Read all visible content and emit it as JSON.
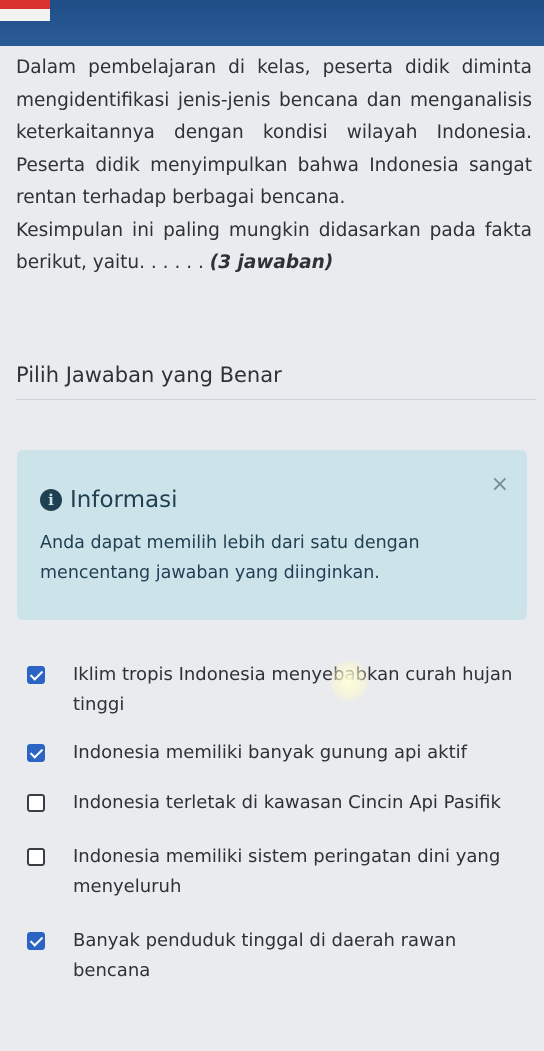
{
  "question": {
    "lines": [
      "Dalam pembelajaran di kelas, peserta didik diminta mengidentifikasi jenis-jenis bencana dan menganalisis keterkaitannya dengan kondisi wilayah Indonesia. Peserta didik menyimpulkan bahwa Indonesia sangat rentan terhadap berbagai bencana."
    ],
    "prompt": "Kesimpulan ini paling mungkin didasarkan pada fakta berikut, yaitu. . . . . .",
    "answer_count": "(3 jawaban)"
  },
  "section_title": "Pilih Jawaban yang Benar",
  "info": {
    "icon": "info-circle-icon",
    "title": "Informasi",
    "close_icon": "close-icon",
    "close_glyph": "×",
    "text": "Anda dapat memilih lebih dari satu dengan mencentang jawaban yang diinginkan."
  },
  "options": [
    {
      "label": "Iklim tropis Indonesia menyebabkan curah hujan tinggi",
      "checked": true
    },
    {
      "label": "Indonesia memiliki banyak gunung api aktif",
      "checked": true
    },
    {
      "label": "Indonesia terletak di kawasan Cincin Api Pasifik",
      "checked": false
    },
    {
      "label": "Indonesia memiliki sistem peringatan dini yang menyeluruh",
      "checked": false
    },
    {
      "label": "Banyak penduduk tinggal di daerah rawan bencana",
      "checked": true
    }
  ],
  "colors": {
    "checked": "#2c64c4",
    "info_background": "#cde3ea",
    "header": "#1f4d86"
  }
}
